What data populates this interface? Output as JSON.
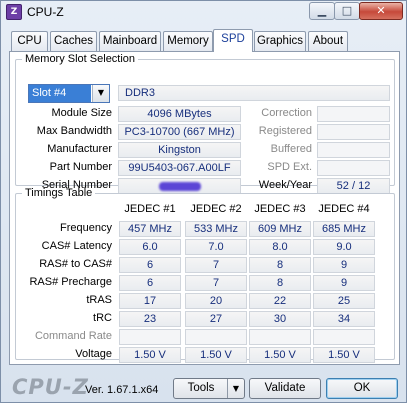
{
  "window": {
    "title": "CPU-Z",
    "icon": "cpu-z-app-icon"
  },
  "window_controls": {
    "minimize": "▁",
    "maximize": "□",
    "close": "✕"
  },
  "tabs": [
    "CPU",
    "Caches",
    "Mainboard",
    "Memory",
    "SPD",
    "Graphics",
    "About"
  ],
  "active_tab": "SPD",
  "slot_section": {
    "legend": "Memory Slot Selection",
    "slot_selected": "Slot #4",
    "memory_type": "DDR3",
    "labels": {
      "module_size": "Module Size",
      "max_bandwidth": "Max Bandwidth",
      "manufacturer": "Manufacturer",
      "part_number": "Part Number",
      "serial_number": "Serial Number",
      "correction": "Correction",
      "registered": "Registered",
      "buffered": "Buffered",
      "spd_ext": "SPD Ext.",
      "week_year": "Week/Year"
    },
    "values": {
      "module_size": "4096 MBytes",
      "max_bandwidth": "PC3-10700 (667 MHz)",
      "manufacturer": "Kingston",
      "part_number": "99U5403-067.A00LF",
      "week_year": "52 / 12"
    }
  },
  "timings": {
    "legend": "Timings Table",
    "columns": [
      "JEDEC #1",
      "JEDEC #2",
      "JEDEC #3",
      "JEDEC #4"
    ],
    "rows": [
      {
        "label": "Frequency",
        "values": [
          "457 MHz",
          "533 MHz",
          "609 MHz",
          "685 MHz"
        ],
        "dim": false
      },
      {
        "label": "CAS# Latency",
        "values": [
          "6.0",
          "7.0",
          "8.0",
          "9.0"
        ],
        "dim": false
      },
      {
        "label": "RAS# to CAS#",
        "values": [
          "6",
          "7",
          "8",
          "9"
        ],
        "dim": false
      },
      {
        "label": "RAS# Precharge",
        "values": [
          "6",
          "7",
          "8",
          "9"
        ],
        "dim": false
      },
      {
        "label": "tRAS",
        "values": [
          "17",
          "20",
          "22",
          "25"
        ],
        "dim": false
      },
      {
        "label": "tRC",
        "values": [
          "23",
          "27",
          "30",
          "34"
        ],
        "dim": false
      },
      {
        "label": "Command Rate",
        "values": [
          "",
          "",
          "",
          ""
        ],
        "dim": true
      },
      {
        "label": "Voltage",
        "values": [
          "1.50 V",
          "1.50 V",
          "1.50 V",
          "1.50 V"
        ],
        "dim": false
      }
    ]
  },
  "footer": {
    "brand": "CPU-Z",
    "version": "Ver. 1.67.1.x64",
    "tools_label": "Tools",
    "validate_label": "Validate",
    "ok_label": "OK"
  }
}
